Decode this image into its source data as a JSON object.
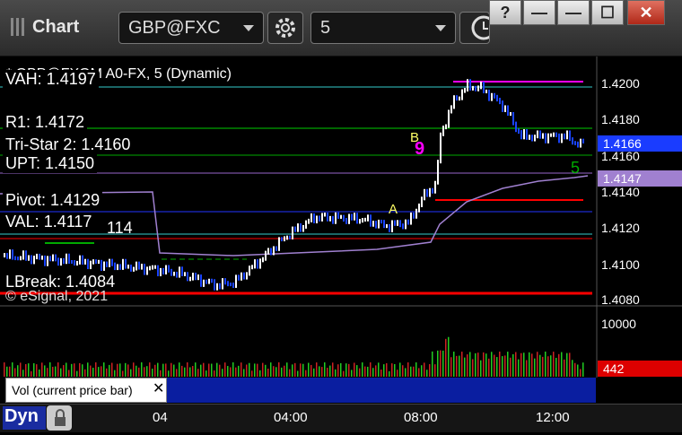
{
  "window": {
    "title": "Chart",
    "symbol": "GBP@FXC",
    "interval": "5",
    "buttons": {
      "help": "?",
      "minimize": "—",
      "maximize": "☐",
      "close": "✕"
    }
  },
  "chart": {
    "header": "* GBP@FXGM A0-FX, 5 (Dynamic)",
    "copyright": "© eSignal, 2021",
    "levels": {
      "vah": "VAH: 1.4197",
      "r1": "R1: 1.4172",
      "tristar": "Tri-Star 2: 1.4160",
      "upt": "UPT: 1.4150",
      "pivot": "Pivot: 1.4129",
      "val": "VAL: 1.4117",
      "partial": "114",
      "lbreak": "LBreak: 1.4084"
    },
    "markers": {
      "a": "A",
      "b": "B",
      "nine": "9",
      "five": "5"
    },
    "price_axis": [
      "1.4200",
      "1.4180",
      "1.4160",
      "1.4140",
      "1.4120",
      "1.4100",
      "1.4080"
    ],
    "price_tags": {
      "last": "1.4166",
      "vwap": "1.4147"
    },
    "volume_axis": "10000",
    "volume_tag": "442",
    "volume_label": "Vol (current price bar)",
    "time_axis": [
      "04",
      "04:00",
      "08:00",
      "12:00"
    ],
    "mode": "Dyn",
    "colors": {
      "up": "#ffffff",
      "down": "#1a44ff",
      "magenta": "#ff00ff",
      "green": "#00ff00",
      "red": "#ff0000",
      "vwap": "#a080d0"
    }
  }
}
